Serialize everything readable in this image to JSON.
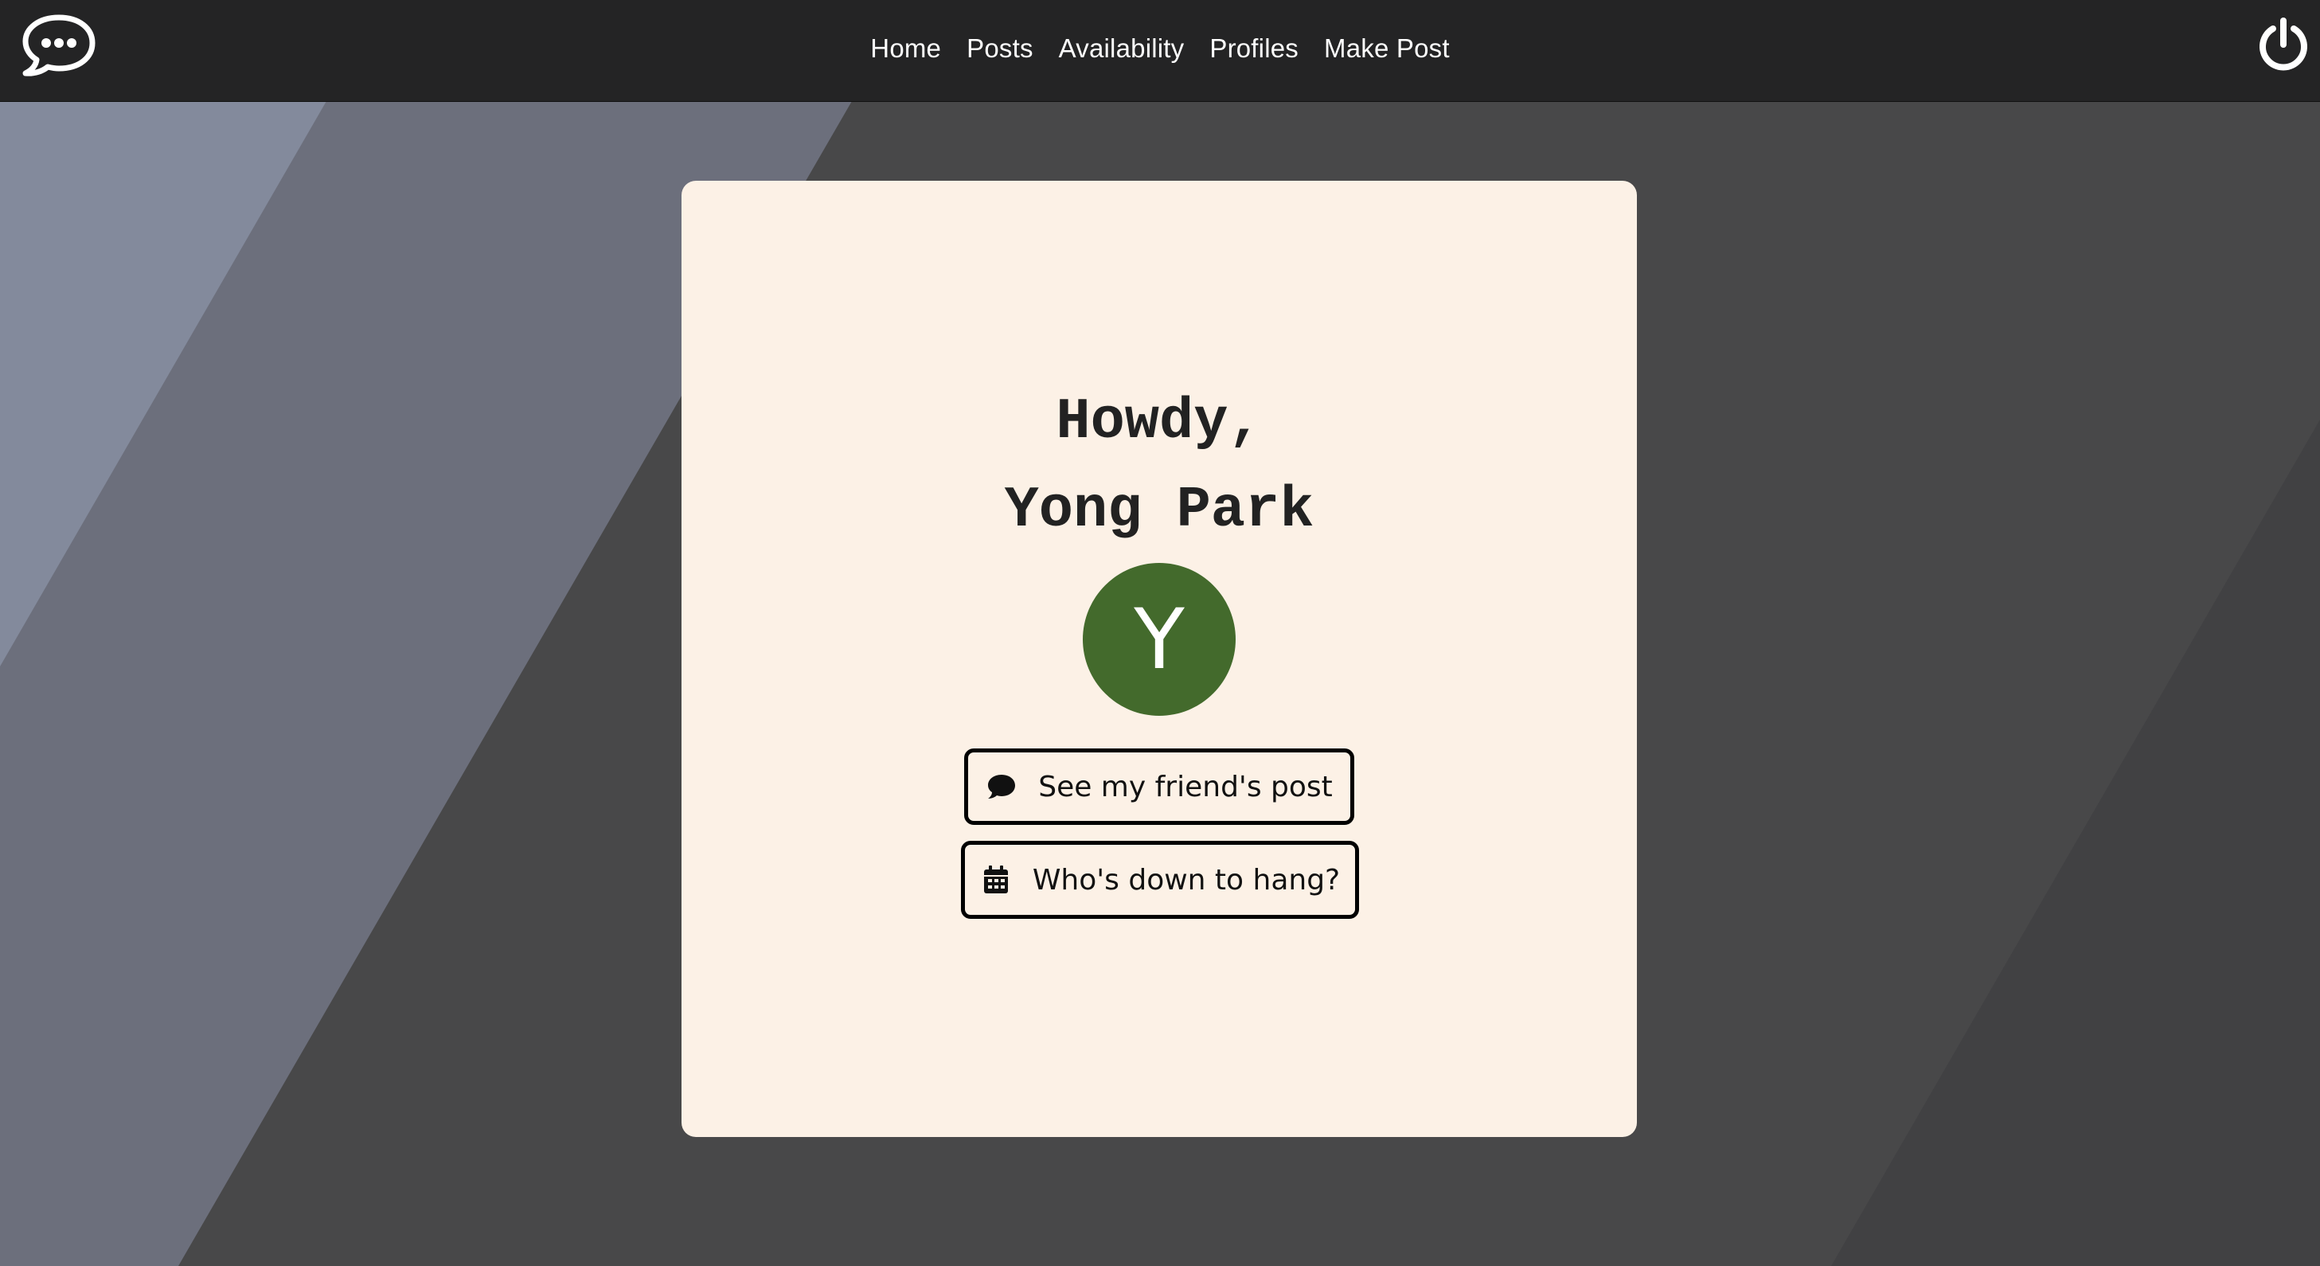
{
  "navbar": {
    "logo_icon": "chat-rocket-logo-icon",
    "links": [
      "Home",
      "Posts",
      "Availability",
      "Profiles",
      "Make Post"
    ],
    "power_icon": "power-icon"
  },
  "card": {
    "greeting_line1": "Howdy,",
    "greeting_line2": "Yong Park",
    "avatar_letter": "Y",
    "buttons": {
      "posts_label": "See my friend's post",
      "posts_icon": "comment-icon",
      "hang_label": "Who's down to hang?",
      "hang_icon": "calendar-icon"
    }
  },
  "colors": {
    "navbar": "#242425",
    "card": "#fcf1e6",
    "avatar": "#436a2c",
    "text": "#222222"
  }
}
